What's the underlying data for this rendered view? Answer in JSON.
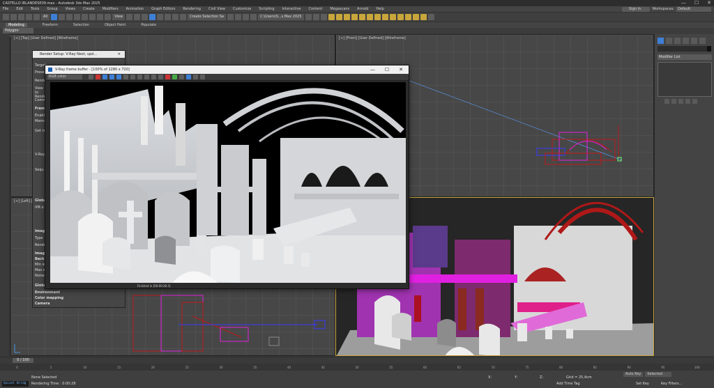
{
  "window": {
    "title": "CASTELLO IRLANDESE09.max - Autodesk 3ds Max 2025",
    "controls": [
      "—",
      "☐",
      "✕"
    ]
  },
  "menu": {
    "items": [
      "File",
      "Edit",
      "Tools",
      "Group",
      "Views",
      "Create",
      "Modifiers",
      "Animation",
      "Graph Editors",
      "Rendering",
      "Civil View",
      "Customize",
      "Scripting",
      "Interactive",
      "Content",
      "Megascans",
      "Arnold",
      "Help"
    ],
    "signin": "Sign In",
    "workspace_label": "Workspaces:",
    "workspace_value": "Default"
  },
  "toolbar": {
    "filter": "All",
    "view": "View",
    "selection_set": "Create Selection Se",
    "path": "C:\\Users\\S...s Max 2025"
  },
  "ribbon": {
    "tabs": [
      "Modeling",
      "Freeform",
      "Selection",
      "Object Paint",
      "Populate"
    ],
    "active_panel": "Polygon Modeling"
  },
  "viewports": {
    "top": "[+] [Top] [User Defined] [Wireframe]",
    "front": "[+] [Front] [User Defined] [Wireframe]",
    "left": "[+] [Left] [",
    "perspective": ""
  },
  "command_panel": {
    "modifier_list": "Modifier List"
  },
  "render_setup": {
    "title": "Render Setup: V-Ray Next, upd...",
    "rows": [
      "Target:",
      "Preset:",
      "Renderer:",
      "View to Render:",
      "Common",
      "Frame",
      "Enable",
      "Memo",
      "Get re",
      "V-Ray",
      "Sequ",
      "Global",
      "IPR o",
      "Image",
      "Type",
      "Render",
      "Image",
      "Back",
      "Min subd",
      "Max s",
      "Noise thr",
      "Global",
      "Environment",
      "Color mapping",
      "Camera"
    ]
  },
  "frame_buffer": {
    "title": "V-Ray frame buffer - [100% of 1280 x 720]",
    "channel": "RGB color",
    "status": "Finished in [00:00:28.3]"
  },
  "timeline": {
    "slider": "0 / 100",
    "ticks": [
      "0",
      "5",
      "10",
      "15",
      "20",
      "25",
      "30",
      "35",
      "40",
      "45",
      "50",
      "55",
      "60",
      "65",
      "70",
      "75",
      "80",
      "85",
      "90",
      "95",
      "100"
    ]
  },
  "status_bar": {
    "maxscript": "Quixel Bridg",
    "selection": "None Selected",
    "rendering_time": "Rendering Time : 0:00:28",
    "x_label": "X:",
    "y_label": "Y:",
    "z_label": "Z:",
    "grid": "Grid = 25,4cm",
    "add_time_tag": "Add Time Tag",
    "auto_key": "Auto Key",
    "selected": "Selected",
    "set_key": "Set Key",
    "key_filters": "Key Filters..."
  },
  "colors": {
    "accent": "#3d7fd6",
    "highlight_border": "#c9a63c",
    "wire_magenta": "#e020e0",
    "wire_red": "#c01818"
  }
}
